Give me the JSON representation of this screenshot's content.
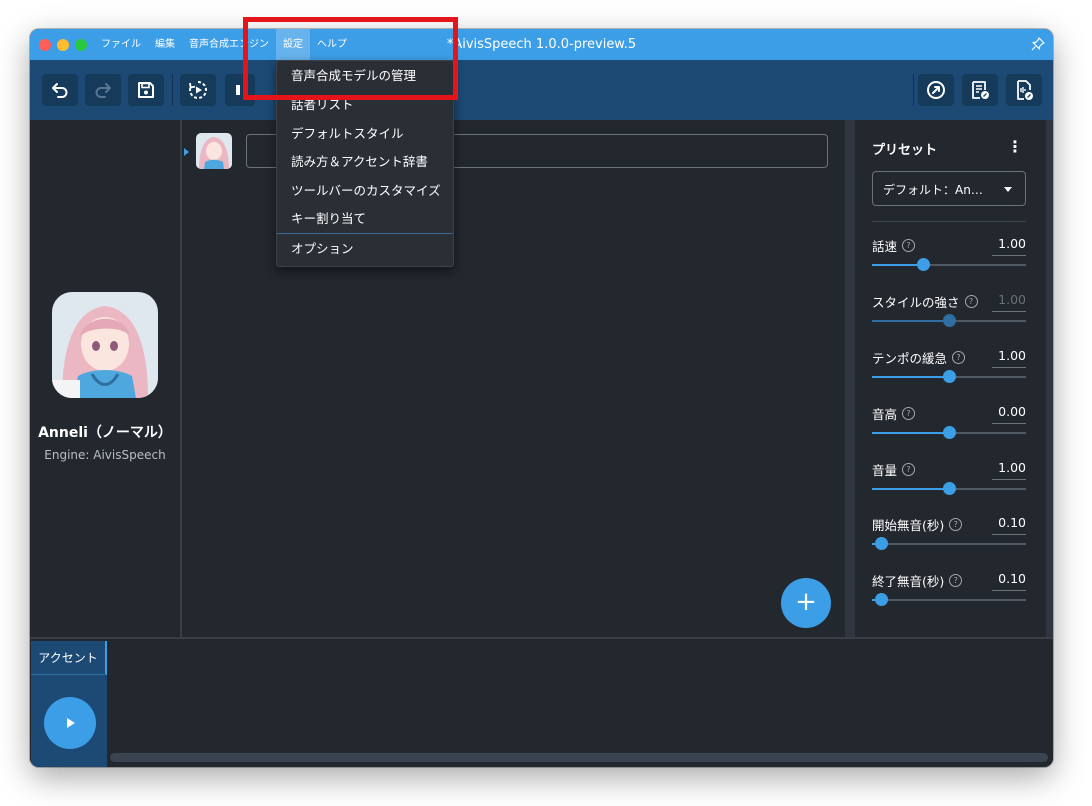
{
  "app": {
    "window_title": "*AivisSpeech 1.0.0-preview.5"
  },
  "menubar": {
    "items": [
      "ファイル",
      "編集",
      "音声合成エンジン",
      "設定",
      "ヘルプ"
    ],
    "active_index": 3
  },
  "toolbar": {
    "left_buttons": [
      "undo-icon",
      "redo-icon",
      "save-icon",
      "play-continuously-icon",
      "stop-icon"
    ],
    "right_buttons": [
      "open-external-icon",
      "export-text-icon",
      "export-audio-icon"
    ]
  },
  "character": {
    "name": "Anneli（ノーマル）",
    "engine": "Engine: AivisSpeech"
  },
  "editor": {
    "rows": [
      {
        "text": ""
      }
    ],
    "add_button": "+"
  },
  "settings_menu": {
    "items": [
      "音声合成モデルの管理",
      "話者リスト",
      "デフォルトスタイル",
      "読み方＆アクセント辞書",
      "ツールバーのカスタマイズ",
      "キー割り当て",
      "オプション"
    ],
    "highlighted_item": "音声合成モデルの管理"
  },
  "preset_panel": {
    "title": "プリセット",
    "selected_preset": "デフォルト：An…",
    "params": [
      {
        "label": "話速",
        "value": "1.00",
        "fraction": 0.33,
        "disabled": false
      },
      {
        "label": "スタイルの強さ",
        "value": "1.00",
        "fraction": 0.5,
        "disabled": true
      },
      {
        "label": "テンポの緩急",
        "value": "1.00",
        "fraction": 0.5,
        "disabled": false
      },
      {
        "label": "音高",
        "value": "0.00",
        "fraction": 0.5,
        "disabled": false
      },
      {
        "label": "音量",
        "value": "1.00",
        "fraction": 0.5,
        "disabled": false
      },
      {
        "label": "開始無音(秒)",
        "value": "0.10",
        "fraction": 0.06,
        "disabled": false
      },
      {
        "label": "終了無音(秒)",
        "value": "0.10",
        "fraction": 0.06,
        "disabled": false
      }
    ]
  },
  "bottom_panel": {
    "tab_label": "アクセント"
  },
  "colors": {
    "accent": "#3d9ee8",
    "toolbar_bg": "#1c4a74",
    "panel_bg": "#23272e",
    "highlight": "#e5141b"
  }
}
